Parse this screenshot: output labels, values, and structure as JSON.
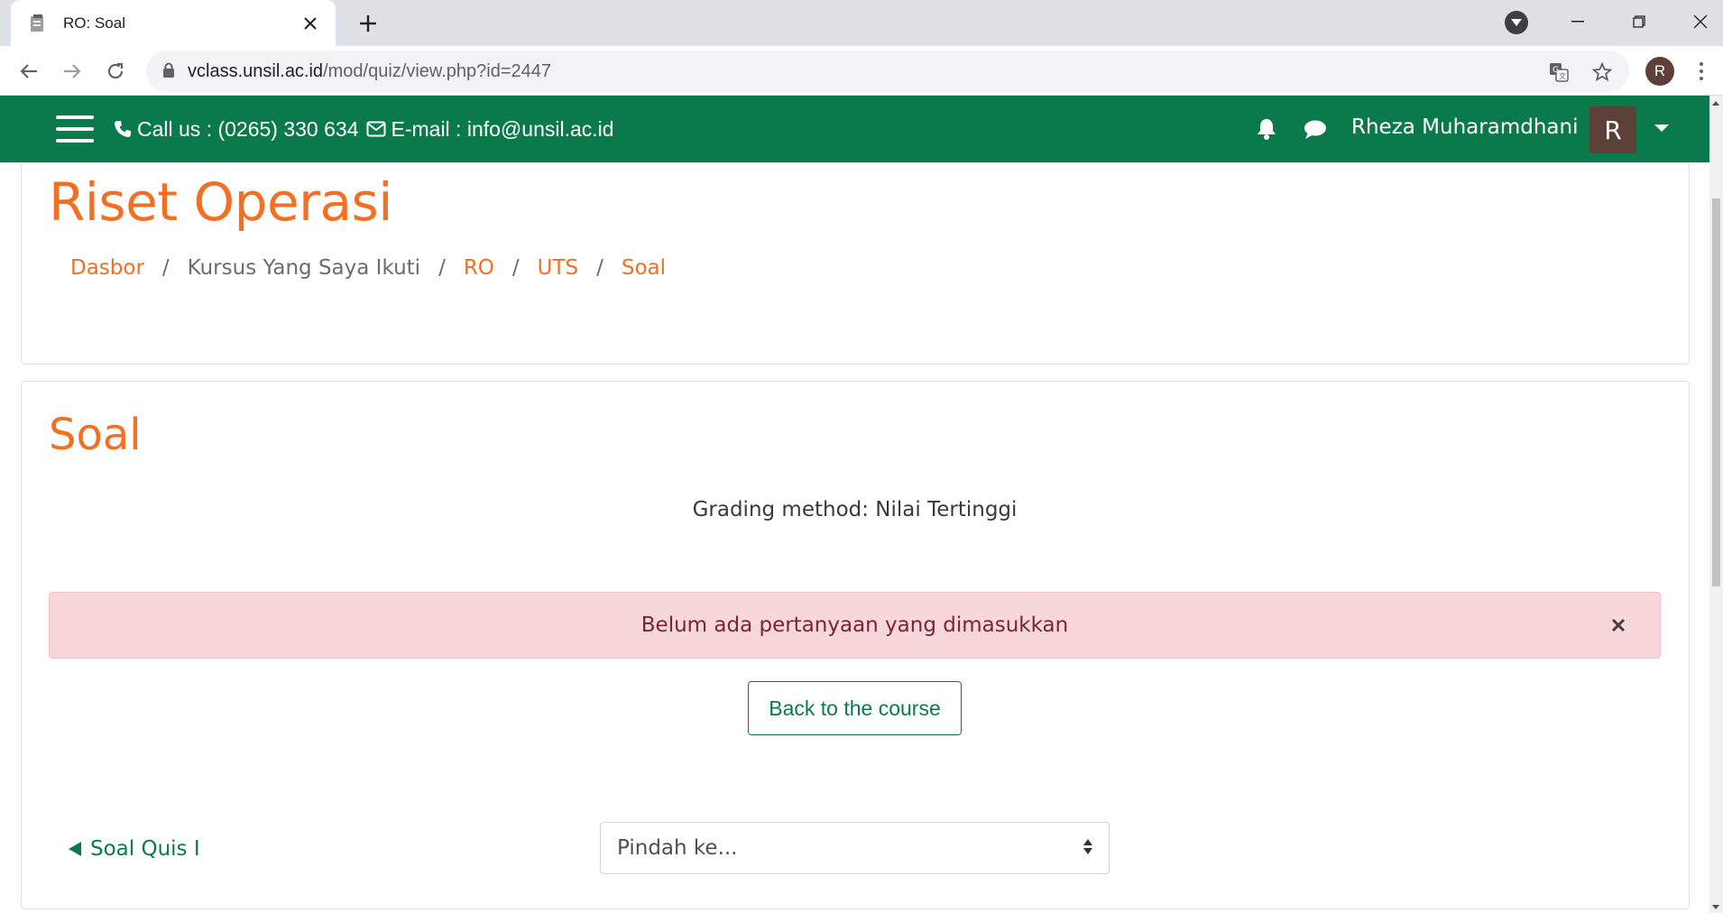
{
  "browser": {
    "tab_title": "RO: Soal",
    "url_host": "vclass.unsil.ac.id",
    "url_path": "/mod/quiz/view.php?id=2447",
    "profile_initial": "R"
  },
  "navbar": {
    "phone_text": "Call us : (0265) 330 634",
    "email_text": "E-mail : info@unsil.ac.id",
    "user_name": "Rheza Muharamdhani",
    "user_initial": "R",
    "bg_color": "#0a7a4b"
  },
  "header": {
    "course_title": "Riset Operasi",
    "breadcrumb": [
      {
        "label": "Dasbor",
        "link": true
      },
      {
        "label": "Kursus Yang Saya Ikuti",
        "link": false
      },
      {
        "label": "RO",
        "link": true
      },
      {
        "label": "UTS",
        "link": true
      },
      {
        "label": "Soal",
        "link": true
      }
    ],
    "separator": "/"
  },
  "main": {
    "page_title": "Soal",
    "grading_method": "Grading method: Nilai Tertinggi",
    "alert_text": "Belum ada pertanyaan yang dimasukkan",
    "back_button": "Back to the course",
    "prev_activity": "Soal Quis I",
    "jump_select_value": "Pindah ke..."
  },
  "colors": {
    "accent_orange": "#f36f21",
    "primary_green": "#0a7a4b",
    "alert_bg": "#f7d7da",
    "alert_text": "#7a2530"
  }
}
